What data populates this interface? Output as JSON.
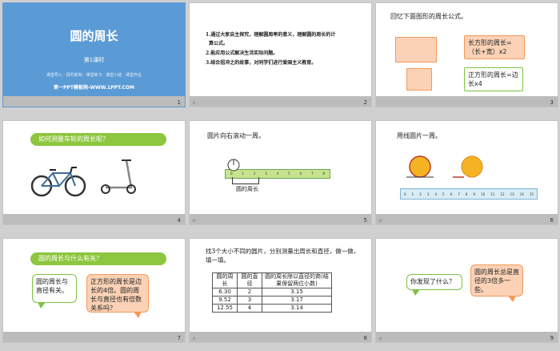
{
  "slides": [
    {
      "num": "1",
      "title": "圆的周长",
      "subtitle": "第1课时",
      "nav": "课堂导入 · 探究新知 · 课堂练习 · 课堂小结 · 课堂作业",
      "site": "第一PPT模板网-WWW.1PPT.COM"
    },
    {
      "num": "2",
      "star": "☆",
      "goals": [
        "1.通过大家自主探究，理解圆周率的意义，理解圆的周长的计",
        "算公式。",
        "2.能应用公式解决生活实际问题。",
        "3.结合祖冲之的故事，对同学们进行爱国主义教育。"
      ]
    },
    {
      "num": "3",
      "title": "回忆下面图形的周长公式。",
      "rect_formula": "长方形的周长=（长+宽）x2",
      "square_formula": "正方形的周长=边长x4"
    },
    {
      "num": "4",
      "question": "如何测量车轮的周长呢？"
    },
    {
      "num": "5",
      "star": "☆",
      "text": "圆片向右滚动一周。",
      "label": "圆的周长",
      "ruler": [
        "0",
        "1",
        "2",
        "3",
        "4",
        "5",
        "6",
        "7",
        "8"
      ]
    },
    {
      "num": "6",
      "star": "☆",
      "text": "用线圆片一周。",
      "ruler": [
        "0",
        "1",
        "2",
        "3",
        "4",
        "5",
        "6",
        "7",
        "8",
        "9",
        "10",
        "11",
        "12",
        "13",
        "14",
        "15"
      ]
    },
    {
      "num": "7",
      "question": "圆的周长与什么有关？",
      "bubble_left": "圆的周长与直径有关。",
      "bubble_right": "正方形的周长是边长的4倍。圆的周长与直径也有倍数关系吗？"
    },
    {
      "num": "8",
      "star": "☆",
      "text": "找3个大小不同的圆片，分别测量出周长和直径，做一做，填一填。",
      "table": {
        "headers": [
          "圆的周长",
          "圆的直径",
          "圆的周长除以直径的商(结果保留两位小数)"
        ],
        "rows": [
          [
            "6.30",
            "2",
            "3.15"
          ],
          [
            "9.52",
            "3",
            "3.17"
          ],
          [
            "12.55",
            "4",
            "3.14"
          ]
        ]
      }
    },
    {
      "num": "9",
      "star": "☆",
      "bubble_left": "你发现了什么？",
      "bubble_right": "圆的周长总是直径的3倍多一些。"
    }
  ],
  "colors": {
    "title_blue": "#5b9bd5",
    "green": "#8dc63f",
    "orange": "#f39a5a",
    "peach": "#fbd2b6",
    "coin": "#f5b324"
  }
}
